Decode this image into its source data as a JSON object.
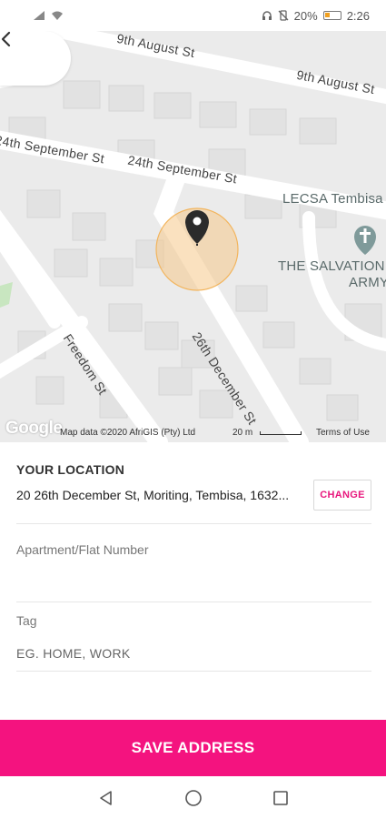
{
  "status_bar": {
    "battery": "20%",
    "time": "2:26"
  },
  "map": {
    "streets": [
      "9th August St",
      "9th August St",
      "24th September St",
      "24th September St",
      "26th December St",
      "Freedom St"
    ],
    "pois": [
      "LECSA Tembisa",
      "THE SALVATION",
      "ARMY"
    ],
    "logo": "Google",
    "attribution": "Map data ©2020 AfriGIS (Pty) Ltd",
    "scale": "20 m",
    "terms": "Terms of Use"
  },
  "form": {
    "location_label": "YOUR LOCATION",
    "address": "20 26th December St, Moriting, Tembisa, 1632...",
    "change_label": "CHANGE",
    "apartment_label": "Apartment/Flat Number",
    "apartment_value": "",
    "tag_label": "Tag",
    "tag_placeholder": "EG. HOME, WORK"
  },
  "save_label": "SAVE ADDRESS",
  "colors": {
    "accent": "#f4137f",
    "change_text": "#e8177d",
    "pin": "#2b2b2b",
    "accuracy_circle": "#f6c98a"
  },
  "icons": {
    "back": "chevron-left-icon",
    "pin": "map-pin-icon",
    "poi": "church-icon",
    "nav_back": "triangle-back-icon",
    "nav_home": "circle-home-icon",
    "nav_recent": "square-recents-icon"
  }
}
